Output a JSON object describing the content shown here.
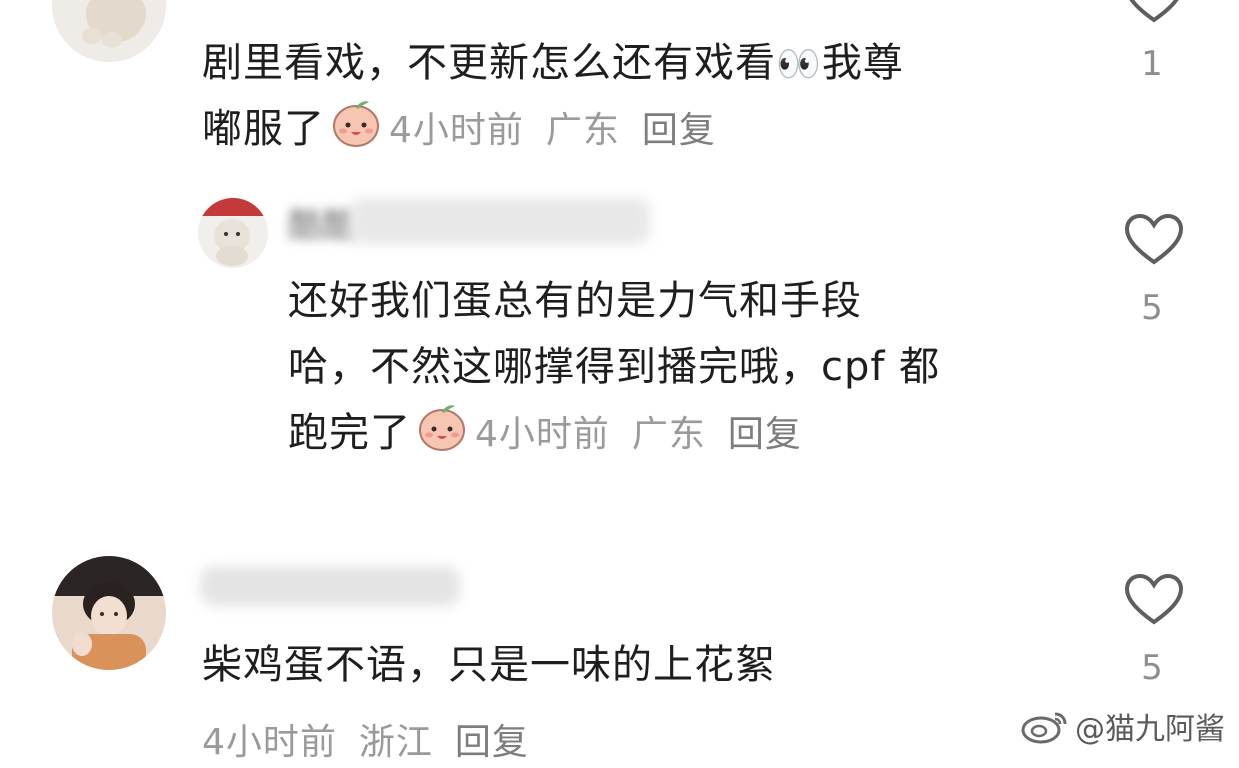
{
  "comments": [
    {
      "text_line1": "剧里看戏，不更新怎么还有戏看",
      "eyes_emoji": "👀",
      "text_line1_end": "我尊",
      "text_line2": "嘟服了",
      "emoji": "peach-smile-emoji",
      "time": "4小时前",
      "location": "广东",
      "reply_label": "回复",
      "likes": "1"
    },
    {
      "username": "酷酷",
      "text_line1": "还好我们蛋总有的是力气和手段",
      "text_line2": "哈，不然这哪撑得到播完哦，cpf 都",
      "text_line3": "跑完了",
      "emoji": "peach-smile-emoji",
      "time": "4小时前",
      "location": "广东",
      "reply_label": "回复",
      "likes": "5"
    },
    {
      "text_line1": "柴鸡蛋不语，只是一味的上花絮",
      "time": "4小时前",
      "location": "浙江",
      "reply_label": "回复",
      "likes": "5"
    }
  ],
  "watermark": "@猫九阿酱",
  "colors": {
    "meta": "#9a9a9a",
    "text": "#1e1e1e",
    "icon": "#5e5e5e"
  }
}
